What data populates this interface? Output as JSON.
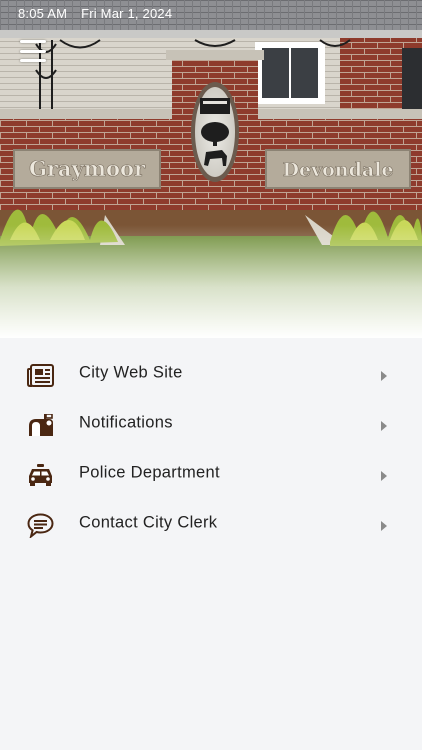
{
  "status_bar": {
    "time": "8:05 AM",
    "date": "Fri Mar 1, 2024"
  },
  "header": {
    "menu_icon": "hamburger-icon",
    "photo": "graymoor-devondale-entrance-sign",
    "sign_left": "Graymoor",
    "sign_right": "Devondale"
  },
  "menu": {
    "items": [
      {
        "label": "City Web Site",
        "icon": "newspaper-icon"
      },
      {
        "label": "Notifications",
        "icon": "mailbox-icon"
      },
      {
        "label": "Police Department",
        "icon": "police-car-icon"
      },
      {
        "label": "Contact City Clerk",
        "icon": "speech-bubble-icon"
      }
    ]
  },
  "colors": {
    "icon_brown": "#4a2712",
    "background": "#f4f5f7",
    "text": "#222222",
    "chevron": "#8a8a8a"
  }
}
